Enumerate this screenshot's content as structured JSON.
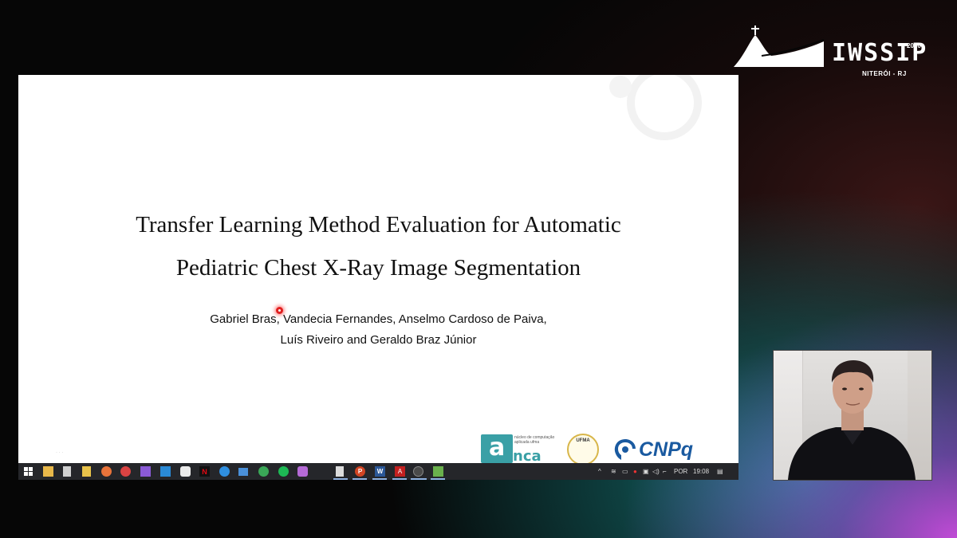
{
  "conference": {
    "name": "IWSSIP",
    "year": "2020",
    "city": "NITERÓI - RJ"
  },
  "slide": {
    "title_line1": "Transfer Learning Method Evaluation for Automatic",
    "title_line2": "Pediatric Chest X-Ray Image Segmentation",
    "authors_line1": "Gabriel Bras, Vandecia Fernandes, Anselmo Cardoso de Paiva,",
    "authors_line2": "Luís Riveiro and Geraldo Braz Júnior",
    "logos": {
      "nca_letter": "a",
      "nca_name": "nca",
      "nca_subtitle": "núcleo de computação aplicada ufma",
      "ufma": "UFMA",
      "cnpq": "CNPq"
    }
  },
  "taskbar": {
    "language": "POR",
    "time": "19:08",
    "tray_arrow": "^"
  },
  "colors": {
    "taskbar": "#25262a",
    "pointer": "#e02020",
    "cnpq_blue": "#1a5aa0",
    "nca_teal": "#3aa0a6"
  }
}
